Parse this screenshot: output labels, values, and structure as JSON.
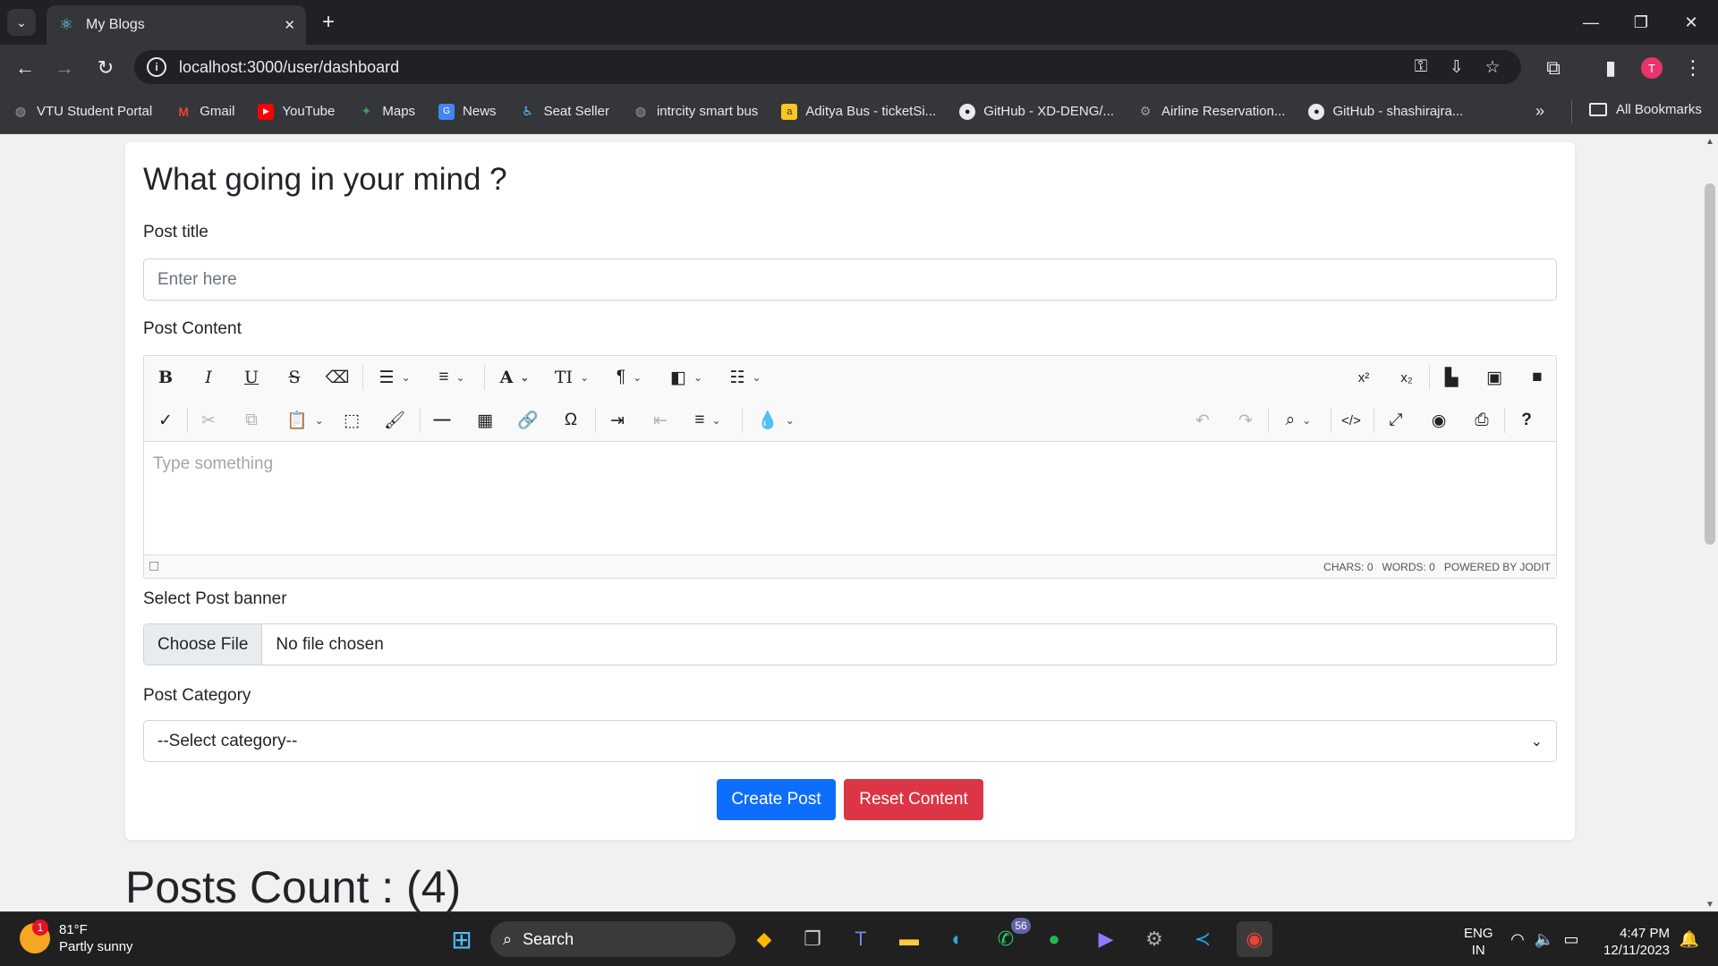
{
  "browser": {
    "tab_title": "My Blogs",
    "url": "localhost:3000/user/dashboard",
    "profile_initial": "T",
    "bookmarks": [
      {
        "label": "VTU Student Portal",
        "icon": "globe-icon"
      },
      {
        "label": "Gmail",
        "icon": "gmail-icon"
      },
      {
        "label": "YouTube",
        "icon": "youtube-icon"
      },
      {
        "label": "Maps",
        "icon": "maps-icon"
      },
      {
        "label": "News",
        "icon": "news-icon"
      },
      {
        "label": "Seat Seller",
        "icon": "seat-seller-icon"
      },
      {
        "label": "intrcity smart bus",
        "icon": "globe-icon"
      },
      {
        "label": "Aditya Bus - ticketSi...",
        "icon": "bus-icon"
      },
      {
        "label": "GitHub - XD-DENG/...",
        "icon": "github-icon"
      },
      {
        "label": "Airline Reservation...",
        "icon": "gear-icon"
      },
      {
        "label": "GitHub - shashirajra...",
        "icon": "github-icon"
      }
    ],
    "all_bookmarks": "All Bookmarks"
  },
  "form": {
    "heading": "What going in your mind ?",
    "title_label": "Post title",
    "title_placeholder": "Enter here",
    "content_label": "Post Content",
    "editor_placeholder": "Type something",
    "editor_chars": "CHARS: 0",
    "editor_words": "WORDS: 0",
    "editor_powered": "POWERED BY JODIT",
    "banner_label": "Select Post banner",
    "choose_file": "Choose File",
    "no_file": "No file chosen",
    "category_label": "Post Category",
    "category_value": "--Select category--",
    "create_button": "Create Post",
    "reset_button": "Reset Content"
  },
  "posts_count": "Posts Count : (4)",
  "taskbar": {
    "temperature": "81°F",
    "weather": "Partly sunny",
    "weather_badge": "1",
    "search": "Search",
    "whatsapp_badge": "56",
    "lang1": "ENG",
    "lang2": "IN",
    "time": "4:47 PM",
    "date": "12/11/2023"
  },
  "colors": {
    "primary": "#0d6efd",
    "danger": "#dc3545",
    "chrome_dark": "#202124",
    "chrome_toolbar": "#35363a"
  }
}
